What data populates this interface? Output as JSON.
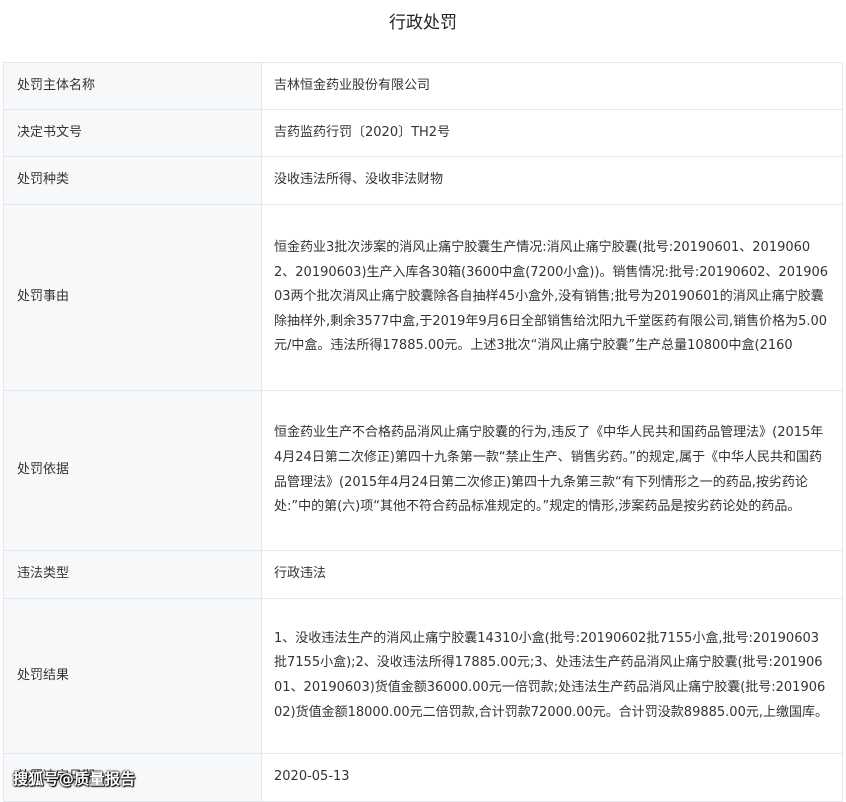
{
  "page_title": "行政处罚",
  "rows": [
    {
      "label": "处罚主体名称",
      "value": "吉林恒金药业股份有限公司"
    },
    {
      "label": "决定书文号",
      "value": "吉药监药行罚〔2020〕TH2号"
    },
    {
      "label": "处罚种类",
      "value": "没收违法所得、没收非法财物"
    },
    {
      "label": "处罚事由",
      "value": "恒金药业3批次涉案的消风止痛宁胶囊生产情况:消风止痛宁胶囊(批号:20190601、20190602、20190603)生产入库各30箱(3600中盒(7200小盒))。销售情况:批号:20190602、20190603两个批次消风止痛宁胶囊除各自抽样45小盒外,没有销售;批号为20190601的消风止痛宁胶囊除抽样外,剩余3577中盒,于2019年9月6日全部销售给沈阳九千堂医药有限公司,销售价格为5.00元/中盒。违法所得17885.00元。上述3批次“消风止痛宁胶囊”生产总量10800中盒(2160"
    },
    {
      "label": "处罚依据",
      "value": "恒金药业生产不合格药品消风止痛宁胶囊的行为,违反了《中华人民共和国药品管理法》(2015年4月24日第二次修正)第四十九条第一款“禁止生产、销售劣药。”的规定,属于《中华人民共和国药品管理法》(2015年4月24日第二次修正)第四十九条第三款“有下列情形之一的药品,按劣药论处:”中的第(六)项“其他不符合药品标准规定的。”规定的情形,涉案药品是按劣药论处的药品。"
    },
    {
      "label": "违法类型",
      "value": "行政违法"
    },
    {
      "label": "处罚结果",
      "value": "1、没收违法生产的消风止痛宁胶囊14310小盒(批号:20190602批7155小盒,批号:20190603批7155小盒);2、没收违法所得17885.00元;3、处违法生产药品消风止痛宁胶囊(批号:20190601、20190603)货值金额36000.00元一倍罚款;处违法生产药品消风止痛宁胶囊(批号:20190602)货值金额18000.00元二倍罚款,合计罚款72000.00元。合计罚没款89885.00元,上缴国库。"
    },
    {
      "label": "处罚决定日期",
      "value": "2020-05-13"
    }
  ],
  "watermark": "搜狐号@质量报告"
}
